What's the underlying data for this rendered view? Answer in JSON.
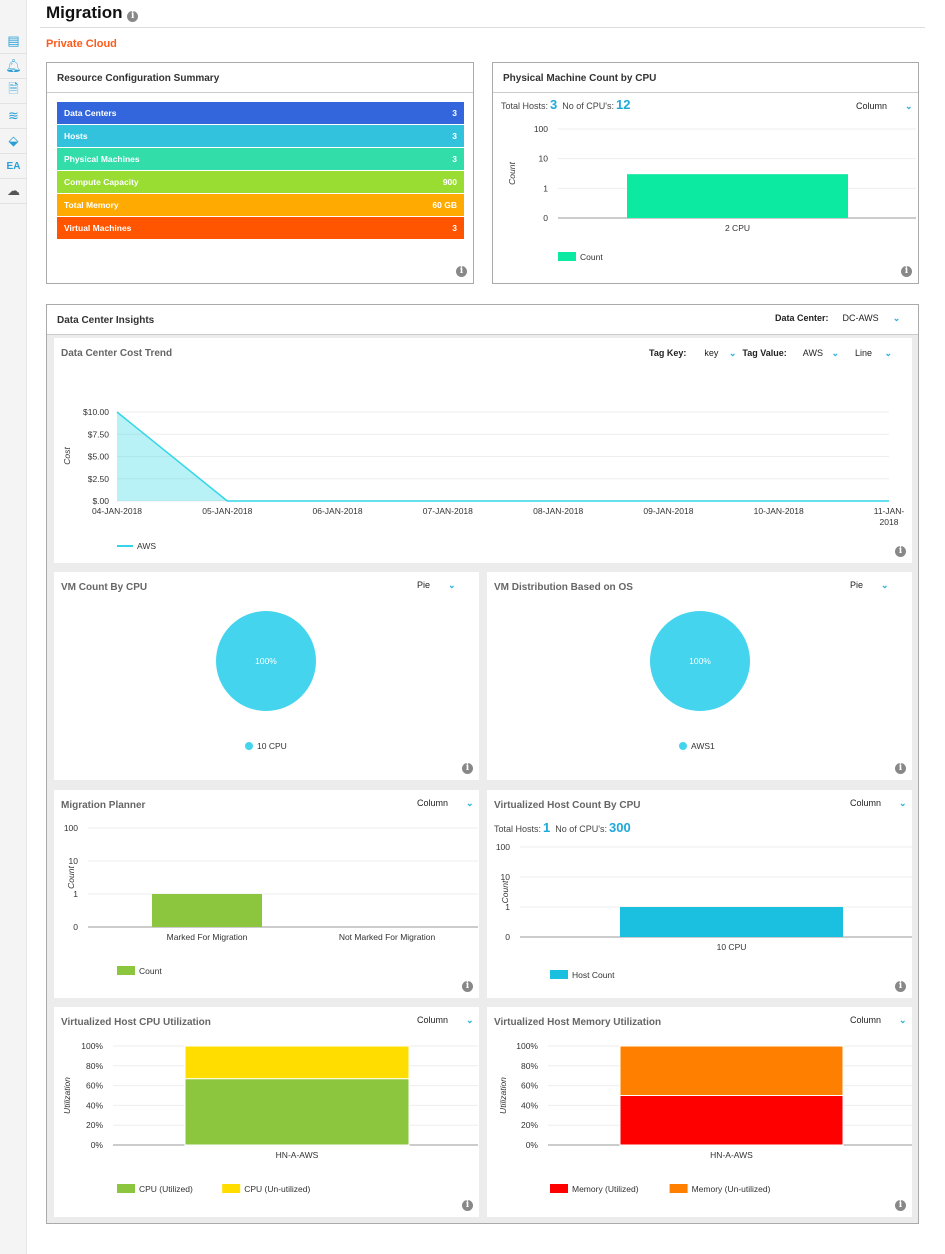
{
  "page": {
    "title": "Migration",
    "section": "Private Cloud"
  },
  "sidebar": {
    "icons": [
      "dashboard-icon",
      "bell-icon",
      "document-icon",
      "layers-icon",
      "tag-icon",
      "ea-icon",
      "cloud-upload-icon"
    ],
    "ea_label": "EA"
  },
  "resource_summary": {
    "title": "Resource Configuration Summary",
    "items": [
      {
        "label": "Data Centers",
        "value": "3",
        "color": "#3366dd"
      },
      {
        "label": "Hosts",
        "value": "3",
        "color": "#33c2dd"
      },
      {
        "label": "Physical Machines",
        "value": "3",
        "color": "#33ddaa"
      },
      {
        "label": "Compute Capacity",
        "value": "900",
        "color": "#99dd33"
      },
      {
        "label": "Total Memory",
        "value": "60 GB",
        "color": "#ffaa00"
      },
      {
        "label": "Virtual Machines",
        "value": "3",
        "color": "#ff5500"
      }
    ]
  },
  "physical": {
    "title": "Physical Machine Count by CPU",
    "total_hosts_label": "Total Hosts:",
    "total_hosts": "3",
    "cpus_label": "No of CPU's:",
    "cpus": "12",
    "chart_type": "Column"
  },
  "insights": {
    "title": "Data Center Insights",
    "dc_label": "Data Center:",
    "dc_value": "DC-AWS"
  },
  "cost": {
    "title": "Data Center Cost Trend",
    "tag_key_label": "Tag Key:",
    "tag_key": "key",
    "tag_value_label": "Tag Value:",
    "tag_value": "AWS",
    "chart_type": "Line"
  },
  "vm_cpu": {
    "title": "VM Count By CPU",
    "chart_type": "Pie"
  },
  "vm_os": {
    "title": "VM Distribution Based on OS",
    "chart_type": "Pie"
  },
  "planner": {
    "title": "Migration Planner",
    "chart_type": "Column"
  },
  "vhost": {
    "title": "Virtualized Host Count By CPU",
    "chart_type": "Column",
    "total_hosts_label": "Total Hosts:",
    "total_hosts": "1",
    "cpus_label": "No of CPU's:",
    "cpus": "300"
  },
  "cpu_util": {
    "title": "Virtualized Host CPU Utilization",
    "chart_type": "Column"
  },
  "mem_util": {
    "title": "Virtualized Host Memory Utilization",
    "chart_type": "Column"
  },
  "chart_data": [
    {
      "id": "physical",
      "type": "bar",
      "yscale": "log",
      "yticks": [
        "100",
        "10",
        "1",
        "0"
      ],
      "ylabel": "Count",
      "categories": [
        "2 CPU"
      ],
      "series": [
        {
          "name": "Count",
          "values": [
            3
          ],
          "color": "#0ce9a0"
        }
      ]
    },
    {
      "id": "cost",
      "type": "area",
      "ylabel": "Cost",
      "yticks": [
        "$10.00",
        "$7.50",
        "$5.00",
        "$2.50",
        "$.00"
      ],
      "ylim": [
        0,
        10
      ],
      "x": [
        "04-JAN-2018",
        "05-JAN-2018",
        "06-JAN-2018",
        "07-JAN-2018",
        "08-JAN-2018",
        "09-JAN-2018",
        "10-JAN-2018",
        "11-JAN-2018"
      ],
      "series": [
        {
          "name": "AWS",
          "values": [
            10,
            0,
            0,
            0,
            0,
            0,
            0,
            0
          ],
          "color": "#33d6e6"
        }
      ]
    },
    {
      "id": "vm_cpu",
      "type": "pie",
      "slices": [
        {
          "label": "10 CPU",
          "value": 100,
          "text": "100%",
          "color": "#44d4ee"
        }
      ]
    },
    {
      "id": "vm_os",
      "type": "pie",
      "slices": [
        {
          "label": "AWS1",
          "value": 100,
          "text": "100%",
          "color": "#44d4ee"
        }
      ]
    },
    {
      "id": "planner",
      "type": "bar",
      "yscale": "log",
      "yticks": [
        "100",
        "10",
        "1",
        "0"
      ],
      "ylabel": "Count",
      "categories": [
        "Marked For Migration",
        "Not Marked For Migration"
      ],
      "series": [
        {
          "name": "Count",
          "values": [
            1,
            0
          ],
          "color": "#8cc63f"
        }
      ]
    },
    {
      "id": "vhost",
      "type": "bar",
      "yscale": "log",
      "yticks": [
        "100",
        "10",
        "1",
        "0"
      ],
      "ylabel": "Count",
      "categories": [
        "10 CPU"
      ],
      "series": [
        {
          "name": "Host Count",
          "values": [
            1
          ],
          "color": "#1bbfdf"
        }
      ]
    },
    {
      "id": "cpu_util",
      "type": "stacked-bar",
      "ylabel": "Utilization",
      "yticks": [
        "100%",
        "80%",
        "60%",
        "40%",
        "20%",
        "0%"
      ],
      "ylim": [
        0,
        100
      ],
      "categories": [
        "HN-A-AWS"
      ],
      "series": [
        {
          "name": "CPU (Utilized)",
          "values": [
            67
          ],
          "color": "#8cc63f"
        },
        {
          "name": "CPU (Un-utilized)",
          "values": [
            33
          ],
          "color": "#ffdd00"
        }
      ]
    },
    {
      "id": "mem_util",
      "type": "stacked-bar",
      "ylabel": "Utilization",
      "yticks": [
        "100%",
        "80%",
        "60%",
        "40%",
        "20%",
        "0%"
      ],
      "ylim": [
        0,
        100
      ],
      "categories": [
        "HN-A-AWS"
      ],
      "series": [
        {
          "name": "Memory (Utilized)",
          "values": [
            50
          ],
          "color": "#ff0000"
        },
        {
          "name": "Memory (Un-utilized)",
          "values": [
            50
          ],
          "color": "#ff8000"
        }
      ]
    }
  ]
}
